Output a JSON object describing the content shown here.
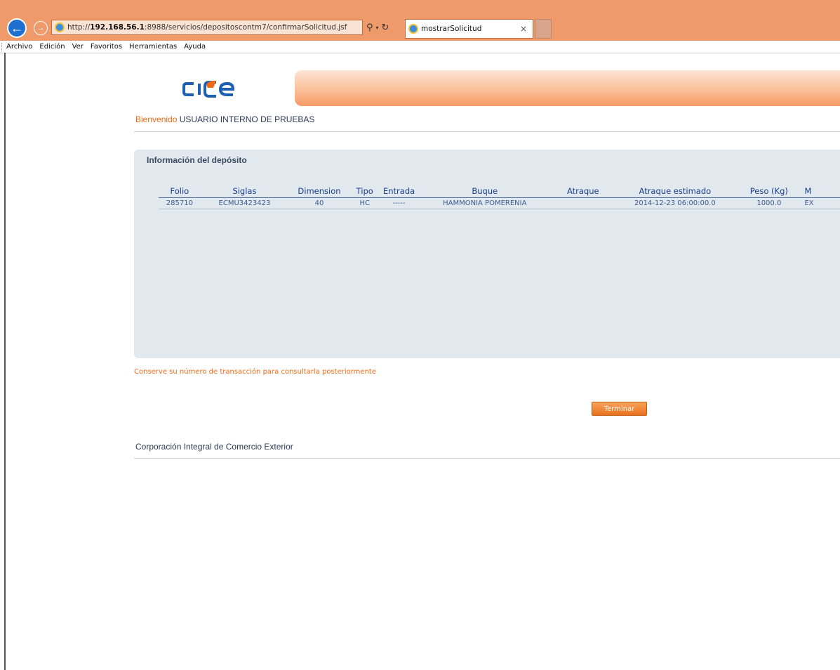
{
  "browser": {
    "url_prefix": "http://",
    "url_host": "192.168.56.1",
    "url_path": ":8988/servicios/depositoscontm7/confirmarSolicitud.jsf",
    "tab_title": "mostrarSolicitud",
    "tab_close": "×",
    "menu": [
      "Archivo",
      "Edición",
      "Ver",
      "Favoritos",
      "Herramientas",
      "Ayuda"
    ]
  },
  "header": {
    "logo_text": "cice",
    "welcome_word": "Bienvenido",
    "user_name": "USUARIO INTERNO DE PRUEBAS"
  },
  "panel": {
    "title": "Información del depósito",
    "columns": [
      "Folio",
      "Siglas",
      "Dimension",
      "Tipo",
      "Entrada",
      "Buque",
      "Atraque",
      "Atraque estimado",
      "Peso (Kg)",
      "M"
    ],
    "rows": [
      [
        "285710",
        "ECMU3423423",
        "40",
        "HC",
        "-----",
        "HAMMONIA POMERENIA",
        "",
        "2014-12-23 06:00:00.0",
        "1000.0",
        "EX"
      ]
    ]
  },
  "notice": "Conserve su número de transacción para consultarla posteriormente",
  "finish_button": "Terminar",
  "footer": "Corporación Integral de Comercio Exterior",
  "colors": {
    "accent_orange": "#ee6a17",
    "chrome_orange": "#ef9a6a",
    "panel_bg": "#e1e9ef",
    "table_header": "#1a3d8a"
  }
}
